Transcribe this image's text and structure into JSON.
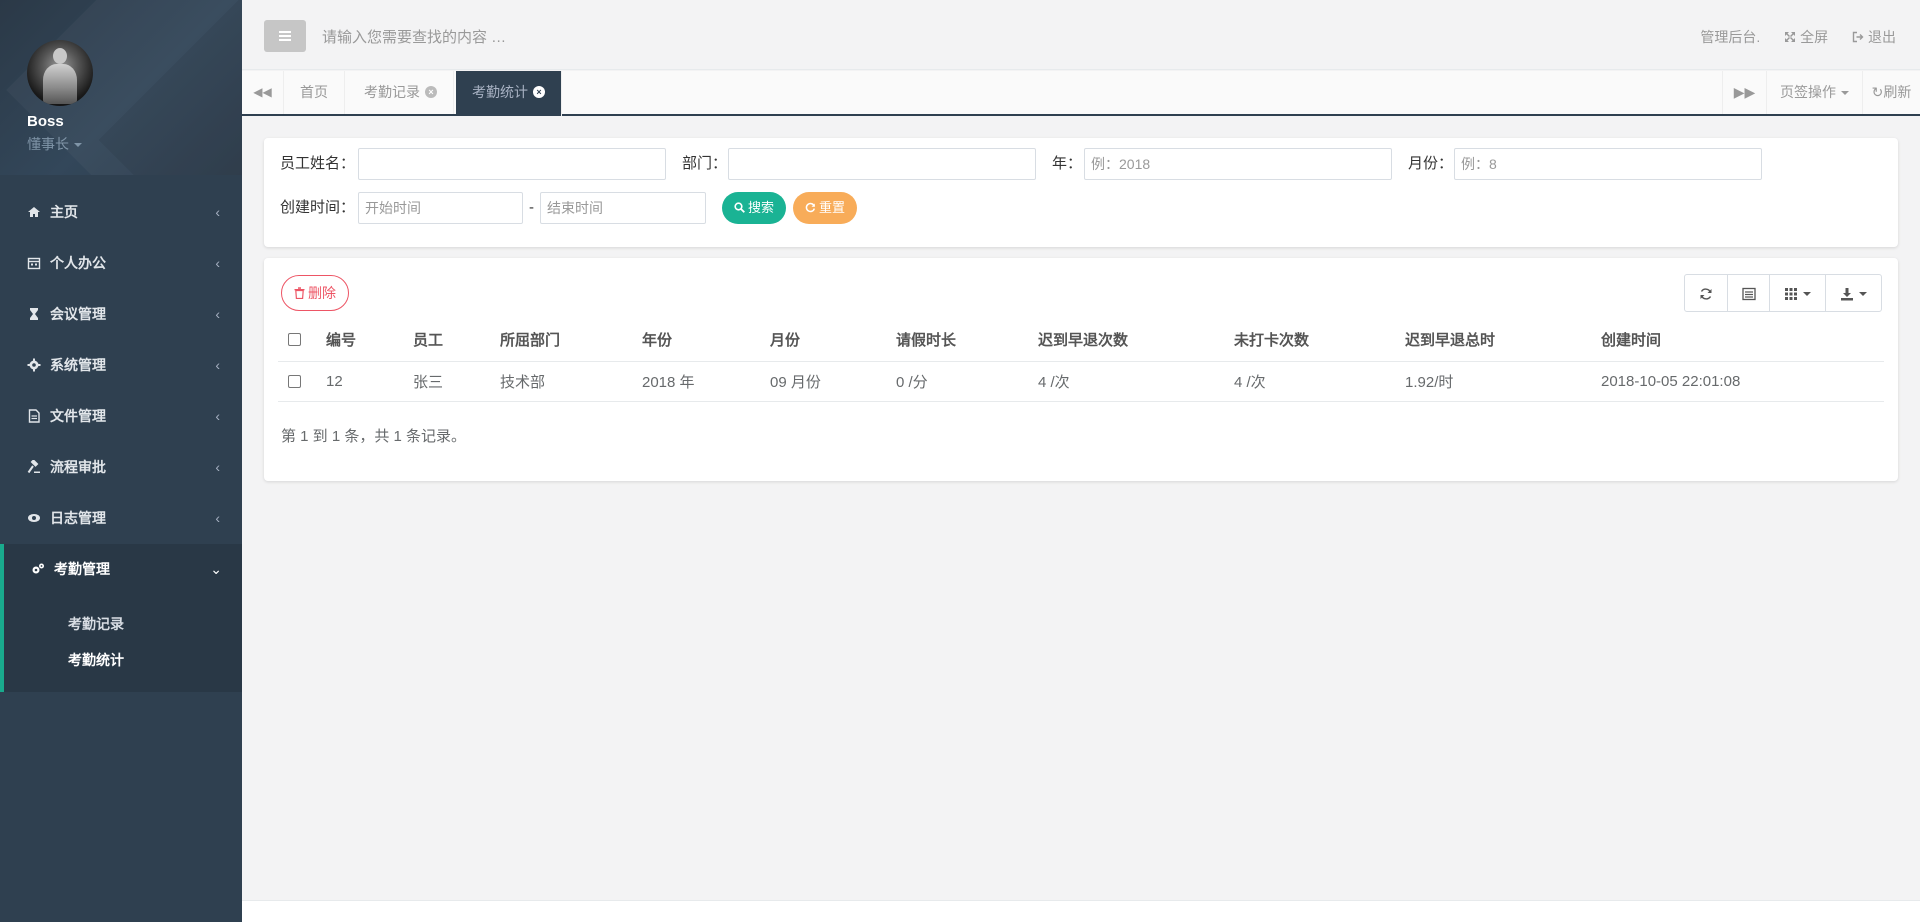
{
  "user": {
    "name": "Boss",
    "role": "懂事长"
  },
  "sidebar": {
    "items": [
      {
        "label": "主页",
        "icon": "home-icon"
      },
      {
        "label": "个人办公",
        "icon": "calendar-icon"
      },
      {
        "label": "会议管理",
        "icon": "hourglass-icon"
      },
      {
        "label": "系统管理",
        "icon": "gear-icon"
      },
      {
        "label": "文件管理",
        "icon": "file-icon"
      },
      {
        "label": "流程审批",
        "icon": "gavel-icon"
      },
      {
        "label": "日志管理",
        "icon": "eye-icon"
      },
      {
        "label": "考勤管理",
        "icon": "gears-icon"
      }
    ],
    "sub_items": [
      "考勤记录",
      "考勤统计"
    ]
  },
  "topbar": {
    "search_placeholder": "请输入您需要查找的内容 …",
    "admin": "管理后台.",
    "fullscreen": "全屏",
    "logout": "退出"
  },
  "tabs": {
    "items": [
      "首页",
      "考勤记录",
      "考勤统计"
    ],
    "active": "考勤统计",
    "tab_ops": "页签操作",
    "refresh": "刷新"
  },
  "search": {
    "employee_label": "员工姓名：",
    "dept_label": "部门：",
    "year_label": "年：",
    "year_placeholder": "例：2018",
    "month_label": "月份：",
    "month_placeholder": "例：8",
    "created_label": "创建时间：",
    "start_placeholder": "开始时间",
    "end_placeholder": "结束时间",
    "dash": "-",
    "search_btn": "搜索",
    "reset_btn": "重置"
  },
  "table": {
    "delete_btn": "删除",
    "columns": [
      "编号",
      "员工",
      "所屈部门",
      "年份",
      "月份",
      "请假时长",
      "迟到早退次数",
      "未打卡次数",
      "迟到早退总时",
      "创建时间"
    ],
    "rows": [
      [
        "12",
        "张三",
        "技术部",
        "2018 年",
        "09 月份",
        "0 /分",
        "4 /次",
        "4 /次",
        "1.92/时",
        "2018-10-05 22:01:08"
      ]
    ],
    "pagination": "第 1 到 1 条，共 1 条记录。"
  }
}
